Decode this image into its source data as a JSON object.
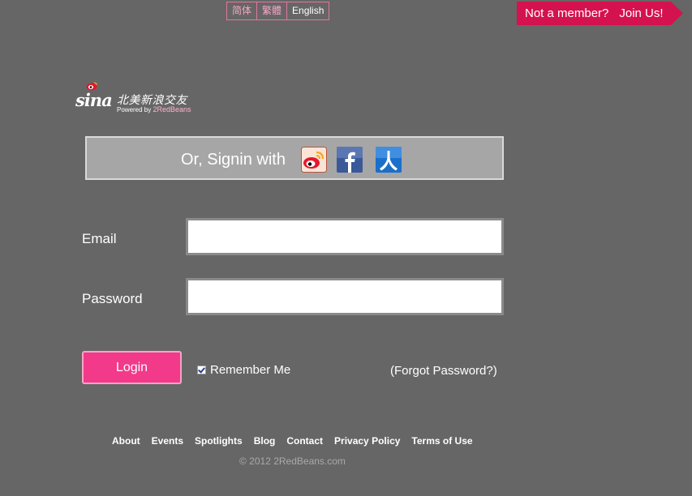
{
  "language_switcher": {
    "items": [
      {
        "label": "简体",
        "active": false
      },
      {
        "label": "繁體",
        "active": false
      },
      {
        "label": "English",
        "active": true
      }
    ]
  },
  "join_banner": {
    "question": "Not a member?",
    "link": "Join Us!",
    "color": "#d4124f"
  },
  "logo": {
    "brand": "sina",
    "chinese": "北美新浪交友",
    "powered_prefix": "Powered by",
    "powered_brand": "2RedBeans"
  },
  "social_signin": {
    "text": "Or, Signin with",
    "icons": [
      "weibo-icon",
      "facebook-icon",
      "renren-icon"
    ]
  },
  "form": {
    "email_label": "Email",
    "email_value": "",
    "password_label": "Password",
    "password_value": "",
    "login_label": "Login",
    "remember_label": "Remember Me",
    "remember_checked": true,
    "forgot_label": "(Forgot Password?)"
  },
  "footer": {
    "links": [
      "About",
      "Events",
      "Spotlights",
      "Blog",
      "Contact",
      "Privacy Policy",
      "Terms of Use"
    ],
    "copyright": "© 2012 2RedBeans.com"
  },
  "colors": {
    "background": "#666666",
    "accent": "#f2398a",
    "social_bar": "#a6a6a6"
  }
}
